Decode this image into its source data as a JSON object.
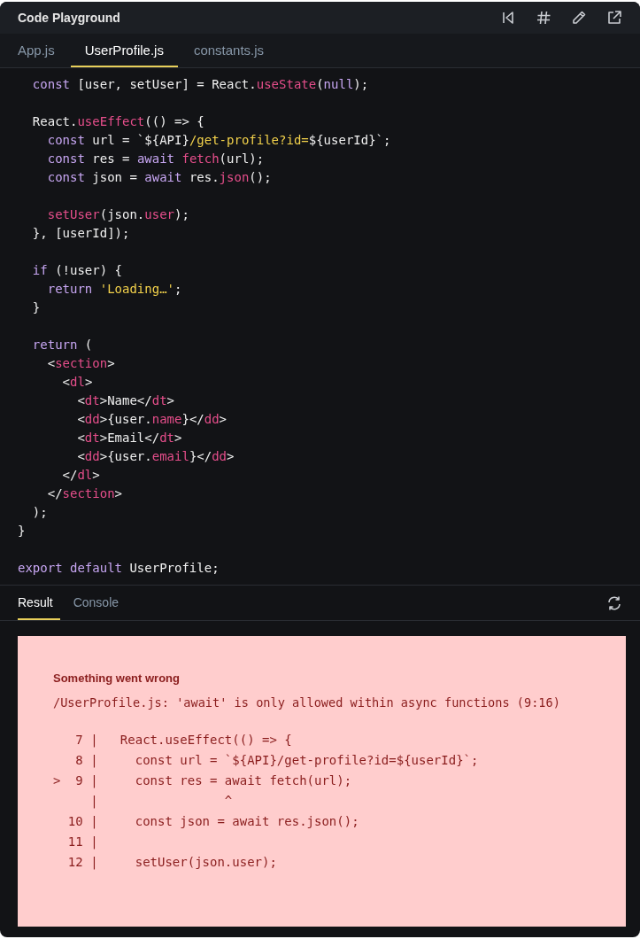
{
  "window": {
    "title": "Code Playground"
  },
  "toolbar": [
    {
      "kind": "reset"
    },
    {
      "kind": "hash"
    },
    {
      "kind": "edit"
    },
    {
      "kind": "open"
    }
  ],
  "file_tabs": [
    {
      "label": "App.js",
      "selected": false
    },
    {
      "label": "UserProfile.js",
      "selected": true
    },
    {
      "label": "constants.js",
      "selected": false
    }
  ],
  "code_lines": [
    {
      "kind": "code",
      "tokens": [
        {
          "kind": "kw",
          "text": "  const "
        },
        {
          "kind": "plain",
          "text": "[user, setUser] = React."
        },
        {
          "kind": "fn",
          "text": "useState"
        },
        {
          "kind": "plain",
          "text": "("
        },
        {
          "kind": "kw",
          "text": "null"
        },
        {
          "kind": "plain",
          "text": ");"
        }
      ]
    },
    {
      "kind": "blank"
    },
    {
      "kind": "code",
      "tokens": [
        {
          "kind": "plain",
          "text": "  React."
        },
        {
          "kind": "fn",
          "text": "useEffect"
        },
        {
          "kind": "plain",
          "text": "(() => {"
        }
      ]
    },
    {
      "kind": "code",
      "tokens": [
        {
          "kind": "kw",
          "text": "    const "
        },
        {
          "kind": "plain",
          "text": "url = `${API}"
        },
        {
          "kind": "str",
          "text": "/get-profile?id="
        },
        {
          "kind": "plain",
          "text": "${userId}`;"
        }
      ]
    },
    {
      "kind": "code",
      "tokens": [
        {
          "kind": "kw",
          "text": "    const "
        },
        {
          "kind": "plain",
          "text": "res = "
        },
        {
          "kind": "kw",
          "text": "await "
        },
        {
          "kind": "fn",
          "text": "fetch"
        },
        {
          "kind": "plain",
          "text": "(url);"
        }
      ]
    },
    {
      "kind": "code",
      "tokens": [
        {
          "kind": "kw",
          "text": "    const "
        },
        {
          "kind": "plain",
          "text": "json = "
        },
        {
          "kind": "kw",
          "text": "await "
        },
        {
          "kind": "plain",
          "text": "res."
        },
        {
          "kind": "fn",
          "text": "json"
        },
        {
          "kind": "plain",
          "text": "();"
        }
      ]
    },
    {
      "kind": "blank"
    },
    {
      "kind": "code",
      "tokens": [
        {
          "kind": "fn",
          "text": "    setUser"
        },
        {
          "kind": "plain",
          "text": "(json."
        },
        {
          "kind": "fn",
          "text": "user"
        },
        {
          "kind": "plain",
          "text": ");"
        }
      ]
    },
    {
      "kind": "code",
      "tokens": [
        {
          "kind": "plain",
          "text": "  }, [userId]);"
        }
      ]
    },
    {
      "kind": "blank"
    },
    {
      "kind": "code",
      "tokens": [
        {
          "kind": "kw",
          "text": "  if "
        },
        {
          "kind": "plain",
          "text": "(!user) {"
        }
      ]
    },
    {
      "kind": "code",
      "tokens": [
        {
          "kind": "kw",
          "text": "    return "
        },
        {
          "kind": "str",
          "text": "'Loading…'"
        },
        {
          "kind": "plain",
          "text": ";"
        }
      ]
    },
    {
      "kind": "code",
      "tokens": [
        {
          "kind": "plain",
          "text": "  }"
        }
      ]
    },
    {
      "kind": "blank"
    },
    {
      "kind": "code",
      "tokens": [
        {
          "kind": "kw",
          "text": "  return "
        },
        {
          "kind": "plain",
          "text": "("
        }
      ]
    },
    {
      "kind": "code",
      "tokens": [
        {
          "kind": "plain",
          "text": "    <"
        },
        {
          "kind": "fn",
          "text": "section"
        },
        {
          "kind": "plain",
          "text": ">"
        }
      ]
    },
    {
      "kind": "code",
      "tokens": [
        {
          "kind": "plain",
          "text": "      <"
        },
        {
          "kind": "fn",
          "text": "dl"
        },
        {
          "kind": "plain",
          "text": ">"
        }
      ]
    },
    {
      "kind": "code",
      "tokens": [
        {
          "kind": "plain",
          "text": "        <"
        },
        {
          "kind": "fn",
          "text": "dt"
        },
        {
          "kind": "plain",
          "text": ">Name</"
        },
        {
          "kind": "fn",
          "text": "dt"
        },
        {
          "kind": "plain",
          "text": ">"
        }
      ]
    },
    {
      "kind": "code",
      "tokens": [
        {
          "kind": "plain",
          "text": "        <"
        },
        {
          "kind": "fn",
          "text": "dd"
        },
        {
          "kind": "plain",
          "text": ">{user."
        },
        {
          "kind": "fn",
          "text": "name"
        },
        {
          "kind": "plain",
          "text": "}</"
        },
        {
          "kind": "fn",
          "text": "dd"
        },
        {
          "kind": "plain",
          "text": ">"
        }
      ]
    },
    {
      "kind": "code",
      "tokens": [
        {
          "kind": "plain",
          "text": "        <"
        },
        {
          "kind": "fn",
          "text": "dt"
        },
        {
          "kind": "plain",
          "text": ">Email</"
        },
        {
          "kind": "fn",
          "text": "dt"
        },
        {
          "kind": "plain",
          "text": ">"
        }
      ]
    },
    {
      "kind": "code",
      "tokens": [
        {
          "kind": "plain",
          "text": "        <"
        },
        {
          "kind": "fn",
          "text": "dd"
        },
        {
          "kind": "plain",
          "text": ">{user."
        },
        {
          "kind": "fn",
          "text": "email"
        },
        {
          "kind": "plain",
          "text": "}</"
        },
        {
          "kind": "fn",
          "text": "dd"
        },
        {
          "kind": "plain",
          "text": ">"
        }
      ]
    },
    {
      "kind": "code",
      "tokens": [
        {
          "kind": "plain",
          "text": "      </"
        },
        {
          "kind": "fn",
          "text": "dl"
        },
        {
          "kind": "plain",
          "text": ">"
        }
      ]
    },
    {
      "kind": "code",
      "tokens": [
        {
          "kind": "plain",
          "text": "    </"
        },
        {
          "kind": "fn",
          "text": "section"
        },
        {
          "kind": "plain",
          "text": ">"
        }
      ]
    },
    {
      "kind": "code",
      "tokens": [
        {
          "kind": "plain",
          "text": "  );"
        }
      ]
    },
    {
      "kind": "code",
      "tokens": [
        {
          "kind": "plain",
          "text": "}"
        }
      ]
    },
    {
      "kind": "blank"
    },
    {
      "kind": "code",
      "tokens": [
        {
          "kind": "kw",
          "text": "export default "
        },
        {
          "kind": "plain",
          "text": "UserProfile;"
        }
      ]
    }
  ],
  "result_tabs": [
    {
      "label": "Result",
      "selected": true
    },
    {
      "label": "Console",
      "selected": false
    }
  ],
  "error": {
    "title": "Something went wrong",
    "message": "/UserProfile.js: 'await' is only allowed within async functions (9:16)",
    "frame_lines": [
      "   7 |   React.useEffect(() => {",
      "   8 |     const url = `${API}/get-profile?id=${userId}`;",
      ">  9 |     const res = await fetch(url);",
      "     |                 ^",
      "  10 |     const json = await res.json();",
      "  11 |",
      "  12 |     setUser(json.user);"
    ]
  }
}
